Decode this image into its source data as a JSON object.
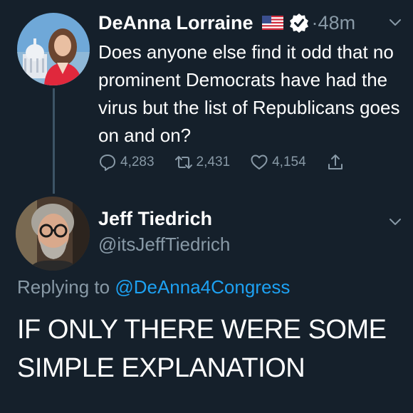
{
  "tweet": {
    "author_name": "DeAnna Lorraine",
    "timestamp": "48m",
    "text": "Does anyone else find it odd that no prominent Democrats have had the virus but the list of Republicans goes on and on?",
    "replies": "4,283",
    "retweets": "2,431",
    "likes": "4,154",
    "icons": {
      "flag": "us-flag-icon",
      "verified": "verified-badge-icon",
      "menu": "chevron-down-icon",
      "reply": "reply-icon",
      "retweet": "retweet-icon",
      "like": "heart-icon",
      "share": "share-icon"
    }
  },
  "reply": {
    "author_name": "Jeff Tiedrich",
    "author_handle": "@itsJeffTiedrich",
    "replying_to_prefix": "Replying to",
    "replying_to_handle": "@DeAnna4Congress",
    "text": "IF ONLY THERE WERE SOME SIMPLE EXPLANATION"
  },
  "colors": {
    "background": "#15202b",
    "primary_text": "#ffffff",
    "secondary_text": "#8899a6",
    "link": "#1da1f2",
    "verified_badge": "#ffffff"
  }
}
